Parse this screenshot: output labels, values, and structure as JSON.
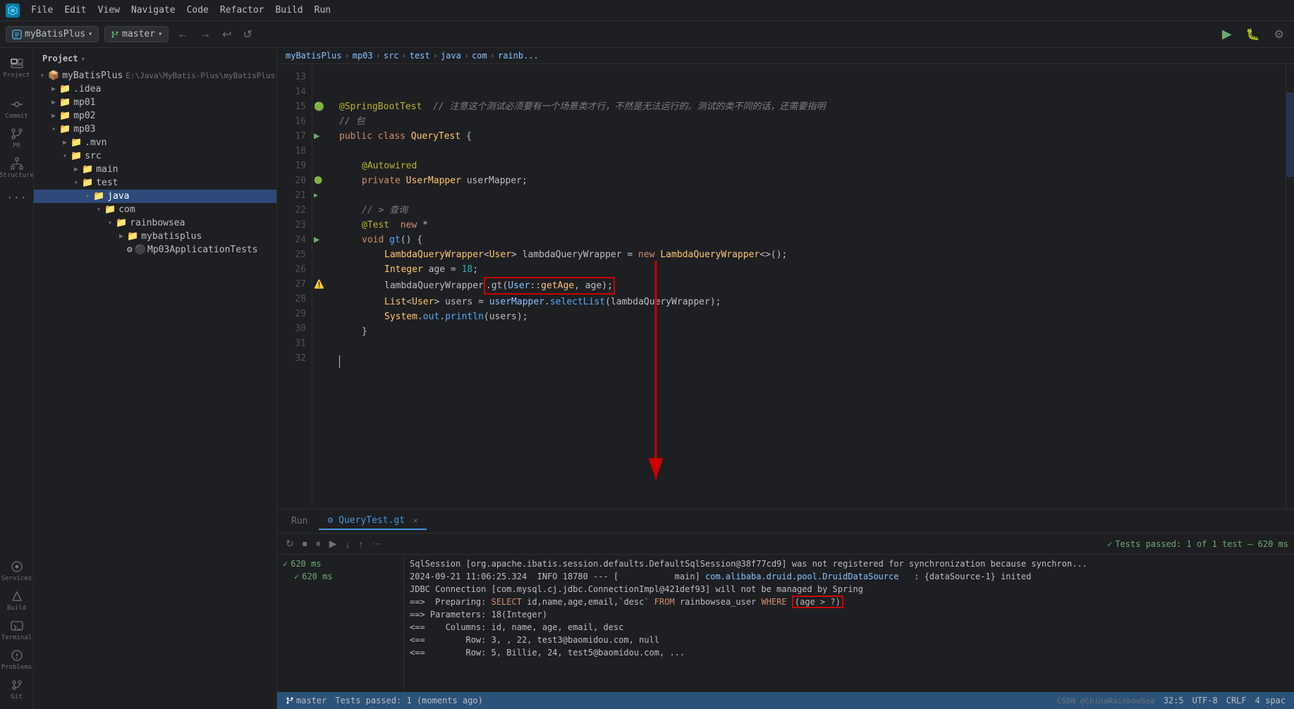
{
  "app": {
    "logo": "♦",
    "title": "myBatisPlus"
  },
  "menu": {
    "items": [
      "File",
      "Edit",
      "View",
      "Navigate",
      "Code",
      "Refactor",
      "Build",
      "Run"
    ]
  },
  "tabbar": {
    "project": "myBatisPlus",
    "branch": "master",
    "nav_back": "←",
    "nav_forward": "→",
    "undo": "↩",
    "redo": "↪"
  },
  "sidebar": {
    "icons": [
      {
        "name": "project",
        "symbol": "📁",
        "label": "Project",
        "active": true
      },
      {
        "name": "commit",
        "symbol": "⊕",
        "label": "Commit"
      },
      {
        "name": "pr",
        "symbol": "⇄",
        "label": "PR"
      },
      {
        "name": "structure",
        "symbol": "⊞",
        "label": "Structure"
      },
      {
        "name": "more",
        "symbol": "...",
        "label": ""
      },
      {
        "name": "services",
        "symbol": "⚙",
        "label": "Services"
      },
      {
        "name": "build",
        "symbol": "🔨",
        "label": "Build"
      },
      {
        "name": "terminal",
        "symbol": "▶",
        "label": "Terminal"
      },
      {
        "name": "problems",
        "symbol": "⚠",
        "label": "Problems"
      },
      {
        "name": "git",
        "symbol": "⑂",
        "label": "Git"
      }
    ]
  },
  "file_tree": {
    "header": "Project",
    "root": "myBatisPlus",
    "root_path": "E:\\Java\\MyBatis-Plus\\myBatisPlus",
    "items": [
      {
        "indent": 1,
        "type": "folder",
        "name": ".idea",
        "expanded": false
      },
      {
        "indent": 1,
        "type": "folder",
        "name": "mp01",
        "expanded": false
      },
      {
        "indent": 1,
        "type": "folder",
        "name": "mp02",
        "expanded": false
      },
      {
        "indent": 1,
        "type": "folder",
        "name": "mp03",
        "expanded": true
      },
      {
        "indent": 2,
        "type": "folder",
        "name": ".mvn",
        "expanded": false
      },
      {
        "indent": 2,
        "type": "folder",
        "name": "src",
        "expanded": true
      },
      {
        "indent": 3,
        "type": "folder",
        "name": "main",
        "expanded": false
      },
      {
        "indent": 3,
        "type": "folder",
        "name": "test",
        "expanded": true
      },
      {
        "indent": 4,
        "type": "folder",
        "name": "java",
        "expanded": true,
        "highlight": true
      },
      {
        "indent": 5,
        "type": "folder",
        "name": "com",
        "expanded": true
      },
      {
        "indent": 6,
        "type": "folder",
        "name": "rainbowsea",
        "expanded": true
      },
      {
        "indent": 7,
        "type": "folder",
        "name": "mybatisplus",
        "expanded": false
      },
      {
        "indent": 7,
        "type": "file",
        "name": "Mp03ApplicationTests",
        "icons": "🔵⚫"
      }
    ]
  },
  "breadcrumb": {
    "items": [
      "myBatisPlus",
      "mp03",
      "src",
      "test",
      "java",
      "com",
      "rainb..."
    ]
  },
  "editor": {
    "tabs": [
      {
        "name": "Run",
        "active": false
      },
      {
        "name": "QueryTest.gt",
        "active": true,
        "closeable": true
      }
    ],
    "lines": [
      {
        "num": 13,
        "content": "",
        "tokens": []
      },
      {
        "num": 14,
        "content": "",
        "tokens": []
      },
      {
        "num": 15,
        "content": "@SpringBootTest  // 注意这个测试必须要有一个场景类才行，不然是无法运行的。测试的类不同的话，还需要指明",
        "gutter": "green"
      },
      {
        "num": 16,
        "content": "// 包",
        "tokens": [
          {
            "type": "comment",
            "text": "// 包"
          }
        ]
      },
      {
        "num": 17,
        "content": "public class QueryTest {",
        "gutter": "run"
      },
      {
        "num": 18,
        "content": "",
        "tokens": []
      },
      {
        "num": 19,
        "content": "    @Autowired",
        "tokens": [
          {
            "type": "annotation",
            "text": "@Autowired"
          }
        ]
      },
      {
        "num": 20,
        "content": "    private UserMapper userMapper;",
        "gutter": "run_leaf"
      },
      {
        "num": 21,
        "content": "",
        "tokens": []
      },
      {
        "num": 22,
        "content": "    // > 查询",
        "tokens": [
          {
            "type": "comment",
            "text": "// > 查询"
          }
        ]
      },
      {
        "num": 23,
        "content": "    @Test  new *",
        "tokens": []
      },
      {
        "num": 24,
        "content": "    void gt() {",
        "gutter": "run"
      },
      {
        "num": 25,
        "content": "        LambdaQueryWrapper<User> lambdaQueryWrapper = new LambdaQueryWrapper<>();",
        "tokens": []
      },
      {
        "num": 26,
        "content": "        Integer age = 18;",
        "tokens": []
      },
      {
        "num": 27,
        "content": "        lambdaQueryWrapper.gt(User::getAge, age);",
        "gutter": "error"
      },
      {
        "num": 28,
        "content": "        List<User> users = userMapper.selectList(lambdaQueryWrapper);",
        "tokens": []
      },
      {
        "num": 29,
        "content": "        System.out.println(users);",
        "tokens": []
      },
      {
        "num": 30,
        "content": "    }",
        "tokens": []
      },
      {
        "num": 31,
        "content": "",
        "tokens": []
      },
      {
        "num": 32,
        "content": "",
        "tokens": [],
        "cursor": true
      }
    ]
  },
  "bottom": {
    "tabs": [
      "Run",
      "QueryTest.gt"
    ],
    "toolbar": {
      "buttons": [
        "↻",
        "⏹",
        "⏸",
        "▶",
        "↓",
        "↑",
        "⋯"
      ]
    },
    "test_result": {
      "label": "Tests passed: 1 of 1 test – 620 ms",
      "suite": "620 ms",
      "case": "620 ms"
    },
    "output_lines": [
      "SqlSession [org.apache.ibatis.session.defaults.DefaultSqlSession@38f77cd9] was not registered for synchronization because synchron...",
      "2024-09-21 11:06:25.324  INFO 18780 --- [           main] com.alibaba.druid.pool.DruidDataSource   : {dataSource-1} inited",
      "JDBC Connection [com.mysql.cj.jdbc.ConnectionImpl@421def93] will not be managed by Spring",
      "==>  Preparing: SELECT id,name,age,email,`desc` FROM rainbowsea_user WHERE (age > ?)",
      "==> Parameters: 18(Integer)",
      "<==    Columns: id, name, age, email, desc",
      "<==        Row: 3, , 22, test3@baomidou.com, null",
      "<==        Row: 5, Billie, 24, test5@baomidou.com, ..."
    ]
  },
  "status_bar": {
    "left": "Tests passed: 1 (moments ago)",
    "position": "32:5",
    "encoding": "UTF-8",
    "line_endings": "CRLF",
    "indent": "4 spac"
  },
  "annotation": {
    "red_box_text": ".gt(User::getAge, age);",
    "bottom_box_text": "(age > ?)"
  },
  "watermark": "CSDN @ChinaRainbowSea"
}
